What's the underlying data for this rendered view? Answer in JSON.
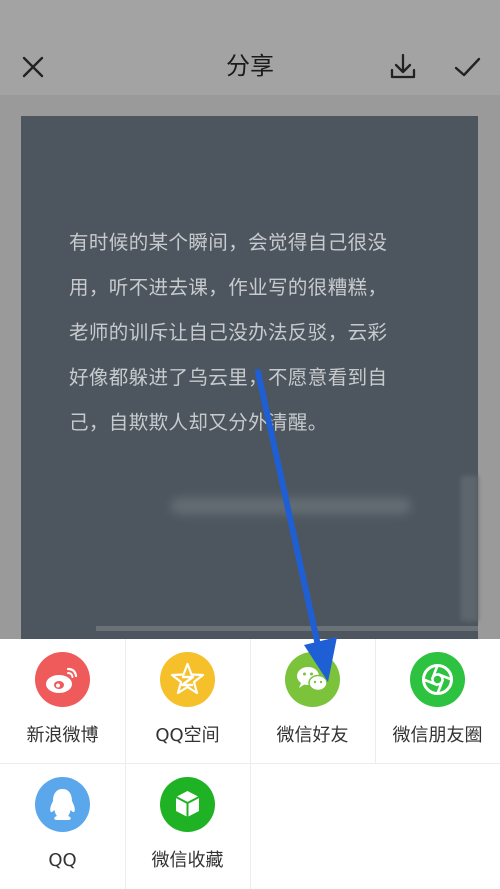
{
  "header": {
    "title": "分享",
    "close_icon": "close-icon",
    "download_icon": "download-icon",
    "confirm_icon": "check-icon"
  },
  "preview": {
    "text_lines": [
      "有时候的某个瞬间，会觉得自己很没",
      "用，听不进去课，作业写的很糟糕，",
      "老师的训斥让自己没办法反驳，云彩",
      "好像都躲进了乌云里，不愿意看到自",
      "己，自欺欺人却又分外清醒。"
    ],
    "background_color": "#4d565e"
  },
  "share_targets": [
    {
      "label": "新浪微博",
      "icon": "weibo-icon",
      "color": "#ef5b5b"
    },
    {
      "label": "QQ空间",
      "icon": "qzone-icon",
      "color": "#f6c02b"
    },
    {
      "label": "微信好友",
      "icon": "wechat-icon",
      "color": "#7ac33b"
    },
    {
      "label": "微信朋友圈",
      "icon": "moments-icon",
      "color": "#2dc23f"
    },
    {
      "label": "QQ",
      "icon": "qq-icon",
      "color": "#5aa7ec"
    },
    {
      "label": "微信收藏",
      "icon": "wechat-favorites-icon",
      "color": "#1fb224"
    }
  ],
  "annotation": {
    "arrow_color": "#1f5fd6",
    "arrow_target": "微信好友"
  }
}
